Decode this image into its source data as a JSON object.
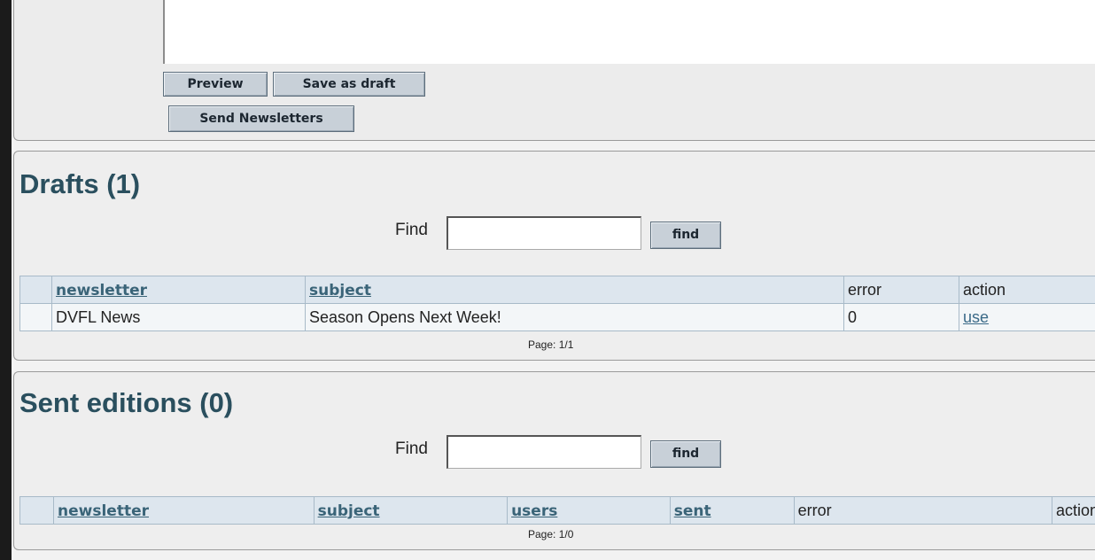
{
  "editor": {
    "preview_label": "Preview",
    "save_draft_label": "Save as draft",
    "send_label": "Send Newsletters"
  },
  "drafts": {
    "title": "Drafts (1)",
    "find_label": "Find",
    "find_value": "",
    "find_button": "find",
    "columns": [
      "newsletter",
      "subject",
      "error",
      "action"
    ],
    "rows": [
      {
        "newsletter": "DVFL News",
        "subject": "Season Opens Next Week!",
        "error": "0",
        "action": "use"
      }
    ],
    "pager": "Page: 1/1"
  },
  "sent": {
    "title": "Sent editions (0)",
    "find_label": "Find",
    "find_value": "",
    "find_button": "find",
    "columns": [
      "newsletter",
      "subject",
      "users",
      "sent",
      "error",
      "action"
    ],
    "pager": "Page: 1/0"
  },
  "colors": {
    "heading": "#2a4f5e",
    "link": "#3a6478",
    "button_bg": "#c8d0d8",
    "table_border": "#a8bac8"
  }
}
